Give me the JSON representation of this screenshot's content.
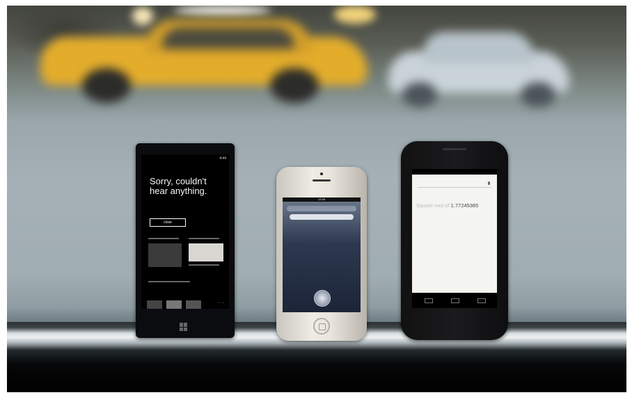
{
  "scene": {
    "description_colors": {
      "taxi": "#e3ad2b",
      "car": "#c9d3d9",
      "sky": "#9aa6ab"
    }
  },
  "phones": {
    "windows_phone": {
      "status_time": "4:44",
      "message": "Sorry, couldn't hear anything.",
      "close_button": "close"
    },
    "iphone": {
      "status_text": "12:45"
    },
    "nexus": {
      "result_prefix": "Square root of",
      "result_value": "1.77245385"
    }
  }
}
